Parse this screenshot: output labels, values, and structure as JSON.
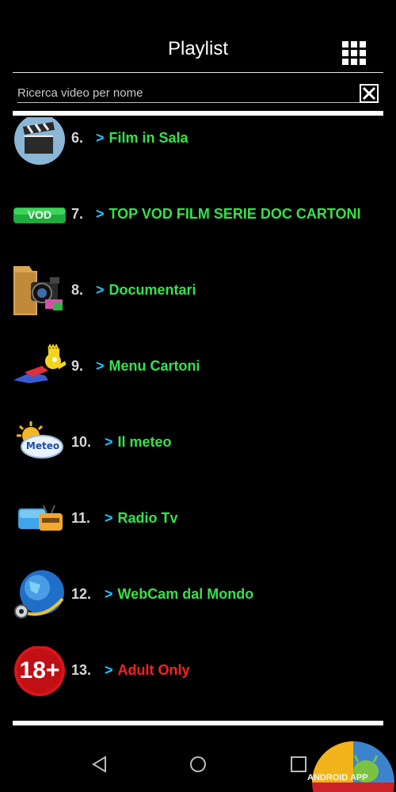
{
  "header": {
    "title": "Playlist"
  },
  "search": {
    "placeholder": "Ricerca video per nome",
    "value": ""
  },
  "icons": {
    "grid": "grid-menu-icon",
    "clear": "close-box-icon"
  },
  "colors": {
    "background": "#000000",
    "label_green": "#34e34a",
    "label_red": "#ff2020",
    "arrow_blue": "#1ec6ff",
    "number_gray": "#d6d6d6"
  },
  "playlist": [
    {
      "number": "6.",
      "arrow": ">",
      "label": "Film in Sala",
      "icon": "clapperboard-icon"
    },
    {
      "number": "7.",
      "arrow": ">",
      "label": "TOP VOD FILM SERIE DOC CARTONI",
      "icon": "vod-badge-icon",
      "icon_text": "VOD"
    },
    {
      "number": "8.",
      "arrow": ">",
      "label": "Documentari",
      "icon": "folder-camera-icon"
    },
    {
      "number": "9.",
      "arrow": ">",
      "label": "Menu Cartoni",
      "icon": "cartoon-character-icon"
    },
    {
      "number": "10.",
      "arrow": ">",
      "label": "Il meteo",
      "icon": "weather-icon",
      "icon_text": "Meteo"
    },
    {
      "number": "11.",
      "arrow": ">",
      "label": "Radio Tv",
      "icon": "tv-radio-icon"
    },
    {
      "number": "12.",
      "arrow": ">",
      "label": "WebCam dal Mondo",
      "icon": "globe-webcam-icon"
    },
    {
      "number": "13.",
      "arrow": ">",
      "label": "Adult Only",
      "icon": "adult-18-icon",
      "icon_text": "18+"
    }
  ],
  "navbar": {
    "back": "back-triangle-icon",
    "home": "home-circle-icon",
    "recents": "recents-square-icon"
  },
  "watermark": {
    "text": "ANDROID APP"
  }
}
